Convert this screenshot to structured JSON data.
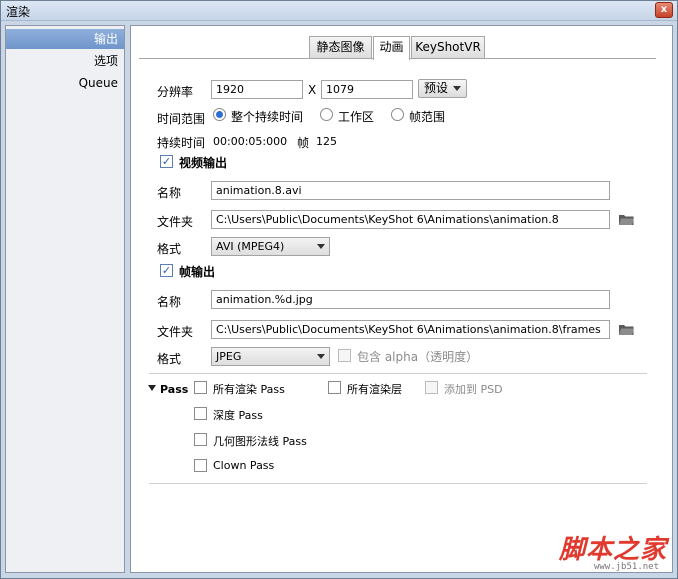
{
  "window": {
    "title": "渲染",
    "close_glyph": "x"
  },
  "sidebar": {
    "items": [
      {
        "label": "输出",
        "active": true
      },
      {
        "label": "选项",
        "active": false
      },
      {
        "label": "Queue",
        "active": false
      }
    ]
  },
  "tabs": [
    {
      "label": "静态图像",
      "active": false
    },
    {
      "label": "动画",
      "active": true
    },
    {
      "label": "KeyShotVR",
      "active": false
    }
  ],
  "resolution": {
    "label": "分辨率",
    "width": "1920",
    "separator": "X",
    "height": "1079",
    "preset_label": "预设"
  },
  "time_range": {
    "label": "时间范围",
    "options": [
      {
        "label": "整个持续时间",
        "selected": true
      },
      {
        "label": "工作区",
        "selected": false
      },
      {
        "label": "帧范围",
        "selected": false
      }
    ]
  },
  "duration": {
    "label": "持续时间",
    "value": "00:00:05:000",
    "frames_label": "帧",
    "frames_value": "125"
  },
  "video_output": {
    "label": "视频输出",
    "checked": true,
    "name_label": "名称",
    "name_value": "animation.8.avi",
    "folder_label": "文件夹",
    "folder_value": "C:\\Users\\Public\\Documents\\KeyShot 6\\Animations\\animation.8",
    "format_label": "格式",
    "format_value": "AVI (MPEG4)"
  },
  "frame_output": {
    "label": "帧输出",
    "checked": true,
    "name_label": "名称",
    "name_value": "animation.%d.jpg",
    "folder_label": "文件夹",
    "folder_value": "C:\\Users\\Public\\Documents\\KeyShot 6\\Animations\\animation.8\\frames",
    "format_label": "格式",
    "format_value": "JPEG",
    "alpha_label": "包含 alpha（透明度）",
    "alpha_checked": false
  },
  "pass": {
    "label": "Pass",
    "all_render_pass": "所有渲染 Pass",
    "all_render_layers": "所有渲染层",
    "add_to_psd": "添加到 PSD",
    "depth_pass": "深度 Pass",
    "normals_pass": "几何图形法线 Pass",
    "clown_pass": "Clown Pass"
  },
  "watermark": {
    "text": "脚本之家",
    "url": "www.jb51.net"
  },
  "colors": {
    "accent": "#2b6fd6",
    "sidebar_active": "#7a9dd0",
    "window_bg": "#c9d6e6"
  }
}
